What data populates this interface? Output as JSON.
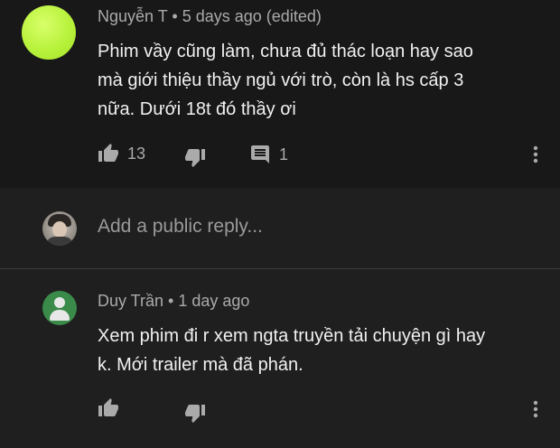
{
  "comments": [
    {
      "author": "Nguyễn T",
      "separator": "•",
      "time": "5 days ago (edited)",
      "text_lines": [
        "Phim vầy cũng làm, chưa đủ thác loạn hay sao",
        "mà giới thiệu thầy ngủ với trò, còn là hs cấp 3",
        "nữa. Dưới 18t đó thầy ơi"
      ],
      "likes": "13",
      "replies": "1",
      "avatar": "lime-circle-avatar"
    },
    {
      "author": "Duy Trần",
      "separator": "•",
      "time": "1 day ago",
      "text_lines": [
        "Xem phim đi r xem ngta truyền tải chuyện gì hay",
        "k. Mới trailer mà đã phán."
      ],
      "avatar": "default-person-avatar"
    }
  ],
  "reply_box": {
    "placeholder": "Add a public reply..."
  },
  "icons": {
    "like": "thumbs-up-icon",
    "dislike": "thumbs-down-icon",
    "reply": "comment-icon",
    "menu": "more-vert-icon"
  },
  "colors": {
    "background": "#181818",
    "panel": "#1f1f1f",
    "text": "#f1f1f1",
    "meta": "#aaaaaa"
  }
}
